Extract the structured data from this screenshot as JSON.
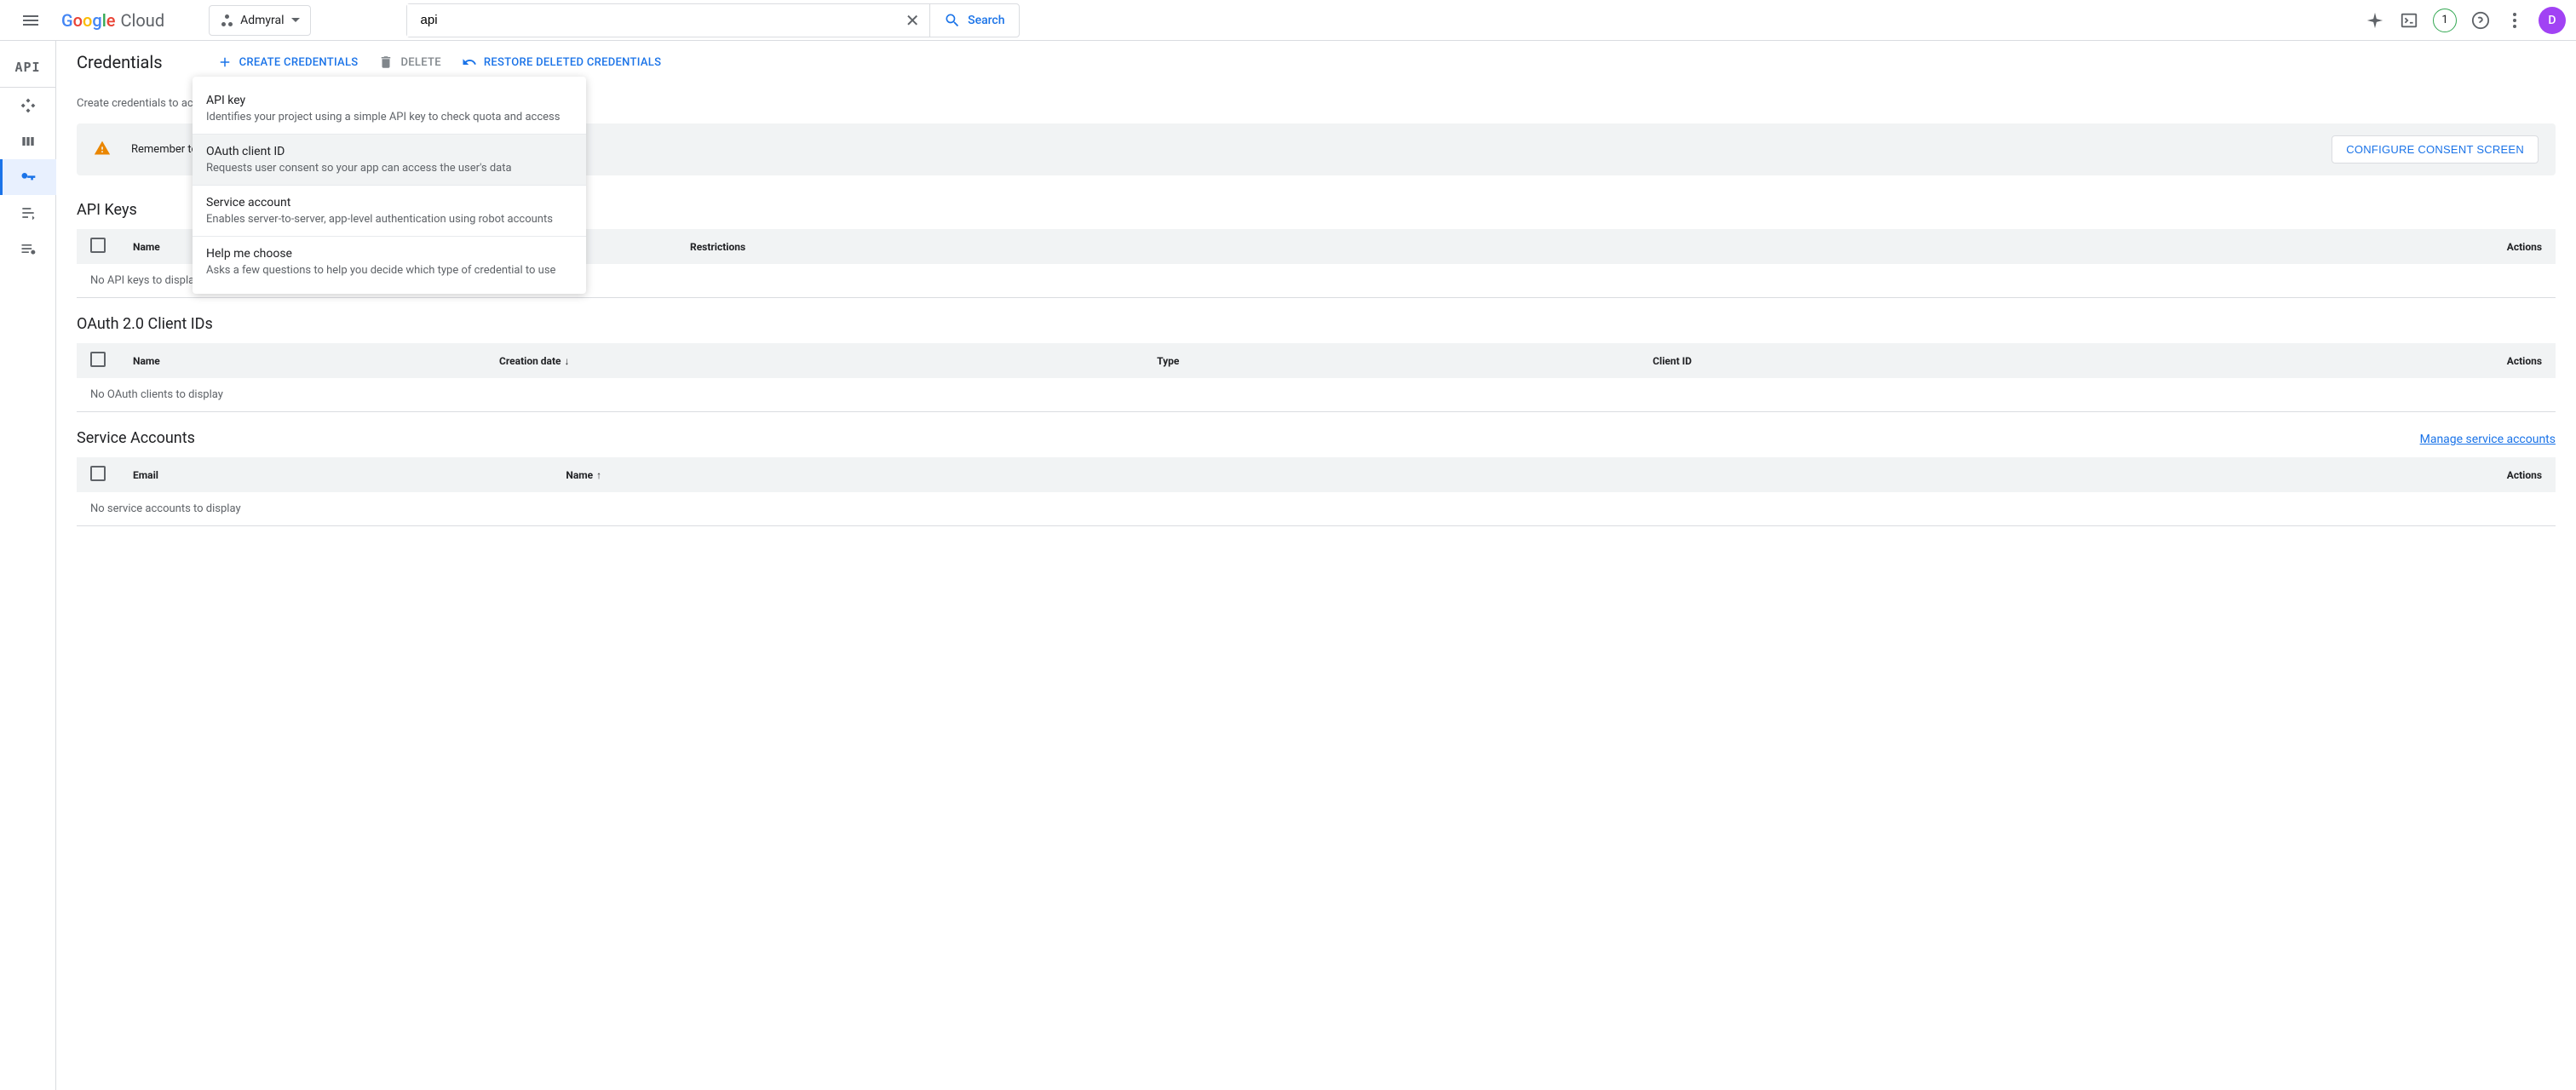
{
  "header": {
    "logo_text": "Google",
    "logo_suffix": "Cloud",
    "project_name": "Admyral",
    "search_value": "api",
    "search_label": "Search",
    "badge_count": "1",
    "avatar_letter": "D"
  },
  "sidebar": {
    "api_label": "API"
  },
  "page": {
    "title": "Credentials",
    "create_label": "CREATE CREDENTIALS",
    "delete_label": "DELETE",
    "restore_label": "RESTORE DELETED CREDENTIALS",
    "help_text": "Create credentials to access your enabled APIs.",
    "alert_text": "Remember to configure the OAuth consent screen with information about your application.",
    "configure_label": "CONFIGURE CONSENT SCREEN"
  },
  "dropdown": {
    "items": [
      {
        "title": "API key",
        "desc": "Identifies your project using a simple API key to check quota and access"
      },
      {
        "title": "OAuth client ID",
        "desc": "Requests user consent so your app can access the user's data"
      },
      {
        "title": "Service account",
        "desc": "Enables server-to-server, app-level authentication using robot accounts"
      },
      {
        "title": "Help me choose",
        "desc": "Asks a few questions to help you decide which type of credential to use"
      }
    ]
  },
  "sections": {
    "api_keys": {
      "title": "API Keys",
      "cols": {
        "name": "Name",
        "restrictions": "Restrictions",
        "actions": "Actions"
      },
      "empty": "No API keys to display"
    },
    "oauth": {
      "title": "OAuth 2.0 Client IDs",
      "cols": {
        "name": "Name",
        "creation": "Creation date",
        "type": "Type",
        "client_id": "Client ID",
        "actions": "Actions"
      },
      "empty": "No OAuth clients to display"
    },
    "service": {
      "title": "Service Accounts",
      "manage": "Manage service accounts",
      "cols": {
        "email": "Email",
        "name": "Name",
        "actions": "Actions"
      },
      "empty": "No service accounts to display"
    }
  }
}
